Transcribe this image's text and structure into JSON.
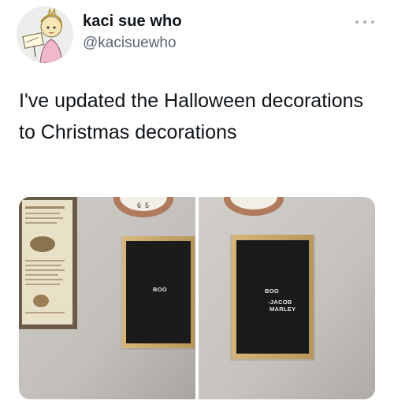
{
  "tweet": {
    "author": {
      "display_name": "kaci sue who",
      "handle": "@kacisuewho",
      "avatar_icon": "cartoon-avatar"
    },
    "more_icon": "more-horizontal-icon",
    "text": "I've updated the Halloween decorations to Christmas decorations",
    "media": {
      "photo_left": {
        "board_text": "BOO"
      },
      "photo_right": {
        "board_text_line1": "BOO",
        "board_text_line2": "-JACOB",
        "board_text_line3": "MARLEY"
      },
      "clock_numeral": "6 5"
    }
  },
  "colors": {
    "text_primary": "#0f1419",
    "text_secondary": "#5b6570",
    "board_frame": "#c9a66b",
    "board_felt": "#1c1c1c",
    "wall": "#c8c6c2"
  }
}
